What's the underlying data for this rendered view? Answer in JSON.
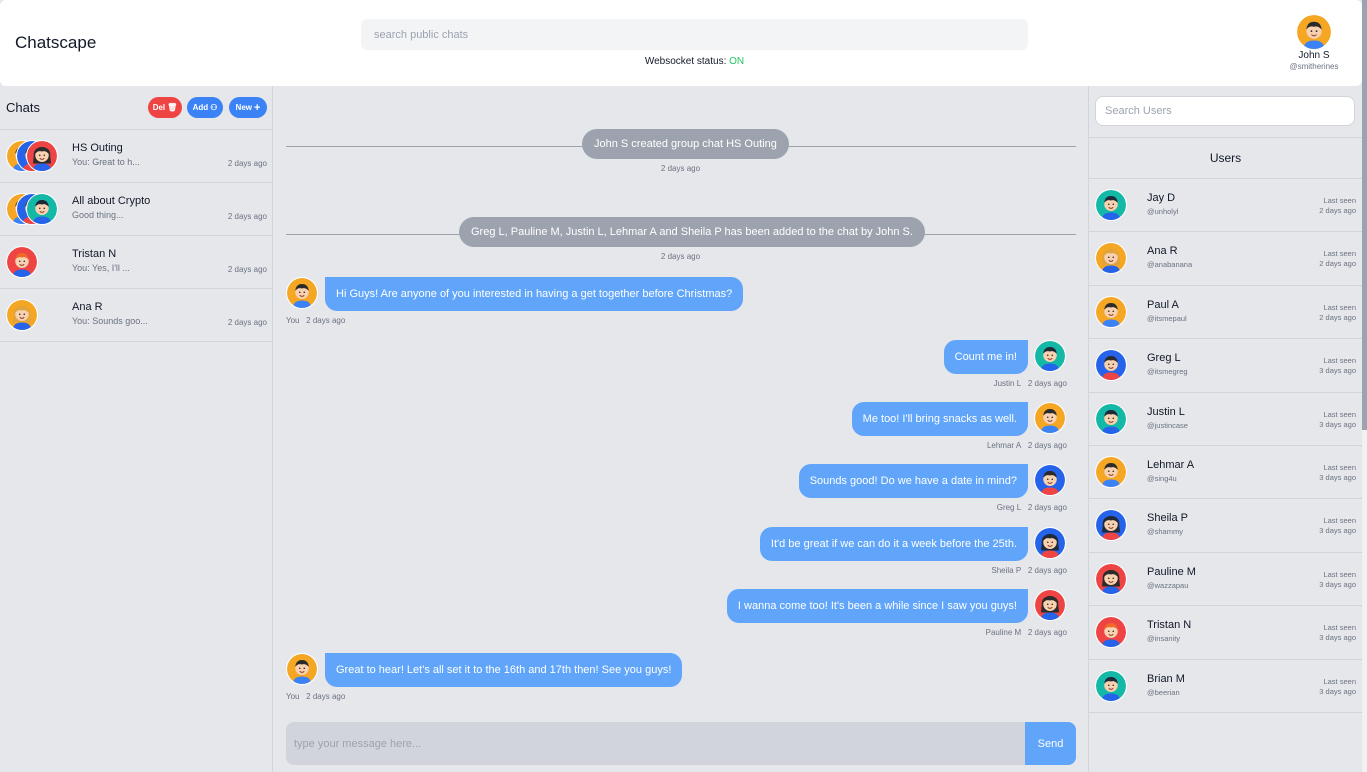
{
  "header": {
    "title": "Chatscape",
    "search_placeholder": "search public chats",
    "ws_label": "Websocket status:",
    "ws_value": "ON",
    "ws_color": "#22c55e",
    "me": {
      "name": "John S",
      "handle": "@smitherines",
      "avatar": "orange-boy"
    }
  },
  "sidebar": {
    "title": "Chats",
    "del_label": "Del",
    "add_label": "Add",
    "new_label": "New",
    "chats": [
      {
        "name": "HS Outing",
        "preview": "You: Great to h...",
        "time": "2 days ago",
        "avatars": [
          "orange-boy",
          "blue-boy",
          "red-girl"
        ]
      },
      {
        "name": "All about Crypto",
        "preview": "Good thing...",
        "time": "2 days ago",
        "avatars": [
          "orange-boy",
          "blue-boy",
          "teal-boy"
        ]
      },
      {
        "name": "Tristan N",
        "preview": "You: Yes, I'll ...",
        "time": "2 days ago",
        "avatars": [
          "red-boy"
        ]
      },
      {
        "name": "Ana R",
        "preview": "You: Sounds goo...",
        "time": "2 days ago",
        "avatars": [
          "orange-girl"
        ]
      }
    ]
  },
  "chat": {
    "system": [
      {
        "text": "John S created group chat HS Outing",
        "time": "2 days ago"
      },
      {
        "text": "Greg L, Pauline M, Justin L, Lehmar A and Sheila P has been added to the chat by John S.",
        "time": "2 days ago"
      }
    ],
    "messages": [
      {
        "side": "in",
        "text": "Hi Guys! Are anyone of you interested in having a get together before Christmas?",
        "sender": "You",
        "time": "2 days ago",
        "avatar": "orange-boy"
      },
      {
        "side": "out",
        "text": "Count me in!",
        "sender": "Justin L",
        "time": "2 days ago",
        "avatar": "teal-boy"
      },
      {
        "side": "out",
        "text": "Me too! I'll bring snacks as well.",
        "sender": "Lehmar A",
        "time": "2 days ago",
        "avatar": "orange-boy"
      },
      {
        "side": "out",
        "text": "Sounds good! Do we have a date in mind?",
        "sender": "Greg L",
        "time": "2 days ago",
        "avatar": "blue-boy"
      },
      {
        "side": "out",
        "text": "It'd be great if we can do it a week before the 25th.",
        "sender": "Sheila P",
        "time": "2 days ago",
        "avatar": "blue-girl"
      },
      {
        "side": "out",
        "text": "I wanna come too! It's been a while since I saw you guys!",
        "sender": "Pauline M",
        "time": "2 days ago",
        "avatar": "red-girl"
      },
      {
        "side": "in",
        "text": "Great to hear! Let's all set it to the 16th and 17th then! See you guys!",
        "sender": "You",
        "time": "2 days ago",
        "avatar": "orange-boy"
      }
    ],
    "compose_placeholder": "type your message here...",
    "send_label": "Send"
  },
  "users_panel": {
    "search_placeholder": "Search Users",
    "title": "Users",
    "last_seen_label": "Last seen",
    "users": [
      {
        "name": "Jay D",
        "handle": "@unholyl",
        "seen": "2 days ago",
        "avatar": "teal-boy"
      },
      {
        "name": "Ana R",
        "handle": "@anabanana",
        "seen": "2 days ago",
        "avatar": "orange-girl"
      },
      {
        "name": "Paul A",
        "handle": "@itsmepaul",
        "seen": "2 days ago",
        "avatar": "orange-boy"
      },
      {
        "name": "Greg L",
        "handle": "@itsmegreg",
        "seen": "3 days ago",
        "avatar": "blue-boy"
      },
      {
        "name": "Justin L",
        "handle": "@justincase",
        "seen": "3 days ago",
        "avatar": "teal-boy"
      },
      {
        "name": "Lehmar A",
        "handle": "@sing4u",
        "seen": "3 days ago",
        "avatar": "orange-boy"
      },
      {
        "name": "Sheila P",
        "handle": "@shammy",
        "seen": "3 days ago",
        "avatar": "blue-girl"
      },
      {
        "name": "Pauline M",
        "handle": "@wazzapau",
        "seen": "3 days ago",
        "avatar": "red-girl"
      },
      {
        "name": "Tristan N",
        "handle": "@insanity",
        "seen": "3 days ago",
        "avatar": "red-boy"
      },
      {
        "name": "Brian M",
        "handle": "@beerian",
        "seen": "3 days ago",
        "avatar": "teal-boy"
      }
    ]
  },
  "colors": {
    "accent": "#60a5fa",
    "danger": "#ef4444",
    "primary": "#3b82f6",
    "panel": "#e5e7eb"
  }
}
